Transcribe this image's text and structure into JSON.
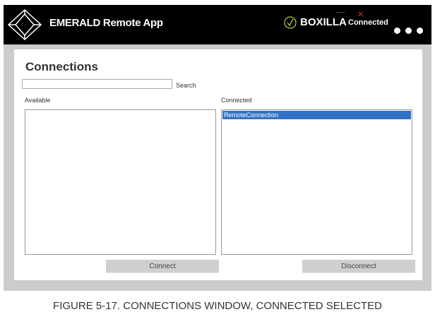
{
  "header": {
    "app_title": "EMERALD Remote App",
    "boxilla_label": "BOXILLA",
    "status": "Connected",
    "close_icon": "close-icon",
    "minimize_icon": "minimize-icon",
    "menu_icon": "more-dots-icon"
  },
  "main": {
    "title": "Connections",
    "search_value": "",
    "search_label": "Search",
    "available_label": "Available",
    "connected_label": "Connected",
    "available_items": [],
    "connected_items": [
      "RemoteConnection"
    ],
    "connect_button": "Connect",
    "disconnect_button": "Disconnect",
    "selection_color": "#3173c6"
  },
  "caption": "FIGURE 5-17. CONNECTIONS WINDOW, CONNECTED SELECTED"
}
